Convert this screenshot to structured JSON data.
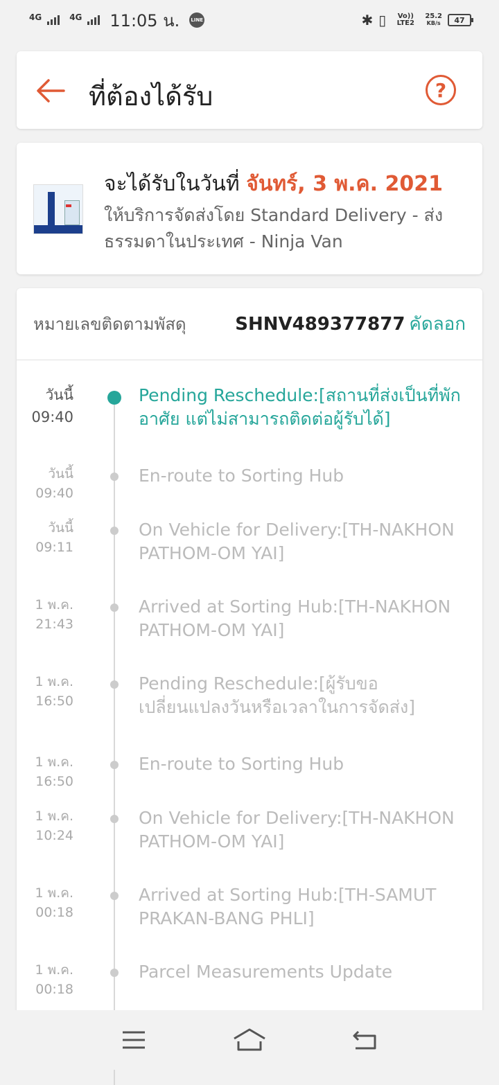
{
  "status_bar": {
    "signal1": "4G",
    "signal2": "4G",
    "time": "11:05 น.",
    "line_badge": "LINE",
    "volte": "Vo)) LTE2",
    "speed_value": "25.2",
    "speed_unit": "KB/s",
    "battery": "47"
  },
  "header": {
    "title": "ที่ต้องได้รับ",
    "help_label": "?"
  },
  "delivery": {
    "eta_prefix": "จะได้รับในวันที่ ",
    "eta_date": "จันทร์, 3 พ.ค. 2021",
    "service": "ให้บริการจัดส่งโดย Standard Delivery - ส่งธรรมดาในประเทศ - Ninja Van"
  },
  "tracking": {
    "label": "หมายเลขติดตามพัสดุ",
    "number": "SHNV489377877",
    "copy_label": "คัดลอก",
    "events": [
      {
        "day": "วันนี้",
        "time": "09:40",
        "text": "Pending Reschedule:[สถานที่ส่งเป็นที่พักอาศัย แต่ไม่สามารถติดต่อผู้รับได้]"
      },
      {
        "day": "วันนี้",
        "time": "09:40",
        "text": "En-route to Sorting Hub"
      },
      {
        "day": "วันนี้",
        "time": "09:11",
        "text": "On Vehicle for Delivery:[TH-NAKHON PATHOM-OM YAI]"
      },
      {
        "day": "1 พ.ค.",
        "time": "21:43",
        "text": "Arrived at Sorting Hub:[TH-NAKHON PATHOM-OM YAI]"
      },
      {
        "day": "1 พ.ค.",
        "time": "16:50",
        "text": "Pending Reschedule:[ผู้รับขอเปลี่ยนแปลงวันหรือเวลาในการจัดส่ง]"
      },
      {
        "day": "1 พ.ค.",
        "time": "16:50",
        "text": "En-route to Sorting Hub"
      },
      {
        "day": "1 พ.ค.",
        "time": "10:24",
        "text": "On Vehicle for Delivery:[TH-NAKHON PATHOM-OM YAI]"
      },
      {
        "day": "1 พ.ค.",
        "time": "00:18",
        "text": "Arrived at Sorting Hub:[TH-SAMUT PRAKAN-BANG PHLI]"
      },
      {
        "day": "1 พ.ค.",
        "time": "00:18",
        "text": "Parcel Measurements Update"
      }
    ]
  },
  "colors": {
    "accent_orange": "#e05a35",
    "accent_teal": "#26a69a"
  }
}
